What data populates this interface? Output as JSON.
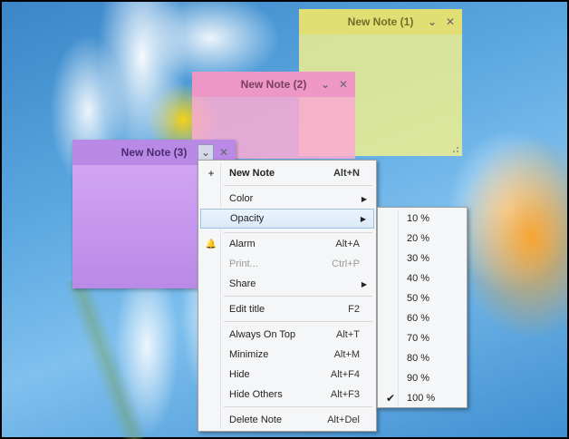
{
  "notes": [
    {
      "title": "New Note (3)",
      "color": "#f4f28c"
    },
    {
      "title": "New Note (2)",
      "color": "#faaad2"
    },
    {
      "title": "New Note (1)",
      "color": "#c79cf0"
    }
  ],
  "note_controls": {
    "dropdown_icon": "chevron-down-icon",
    "close_icon": "close-icon",
    "dropdown_glyph": "⌄",
    "close_glyph": "✕"
  },
  "menu": {
    "items": [
      {
        "label": "New Note",
        "shortcut": "Alt+N",
        "icon": "plus-icon",
        "glyph": "+"
      },
      {
        "label": "Color",
        "shortcut": "",
        "submenu": true
      },
      {
        "label": "Opacity",
        "shortcut": "",
        "submenu": true,
        "highlighted": true
      },
      {
        "label": "Alarm",
        "shortcut": "Alt+A",
        "icon": "bell-icon",
        "glyph": "🔔"
      },
      {
        "label": "Print...",
        "shortcut": "Ctrl+P",
        "disabled": true
      },
      {
        "label": "Share",
        "shortcut": "",
        "submenu": true
      },
      {
        "label": "Edit title",
        "shortcut": "F2"
      },
      {
        "label": "Always On Top",
        "shortcut": "Alt+T"
      },
      {
        "label": "Minimize",
        "shortcut": "Alt+M"
      },
      {
        "label": "Hide",
        "shortcut": "Alt+F4"
      },
      {
        "label": "Hide Others",
        "shortcut": "Alt+F3"
      },
      {
        "label": "Delete Note",
        "shortcut": "Alt+Del"
      }
    ],
    "submenu_arrow": "▶"
  },
  "opacity_menu": {
    "options": [
      "10 %",
      "20 %",
      "30 %",
      "40 %",
      "50 %",
      "60 %",
      "70 %",
      "80 %",
      "90 %",
      "100 %"
    ],
    "selected": "100 %",
    "check_glyph": "✔"
  }
}
